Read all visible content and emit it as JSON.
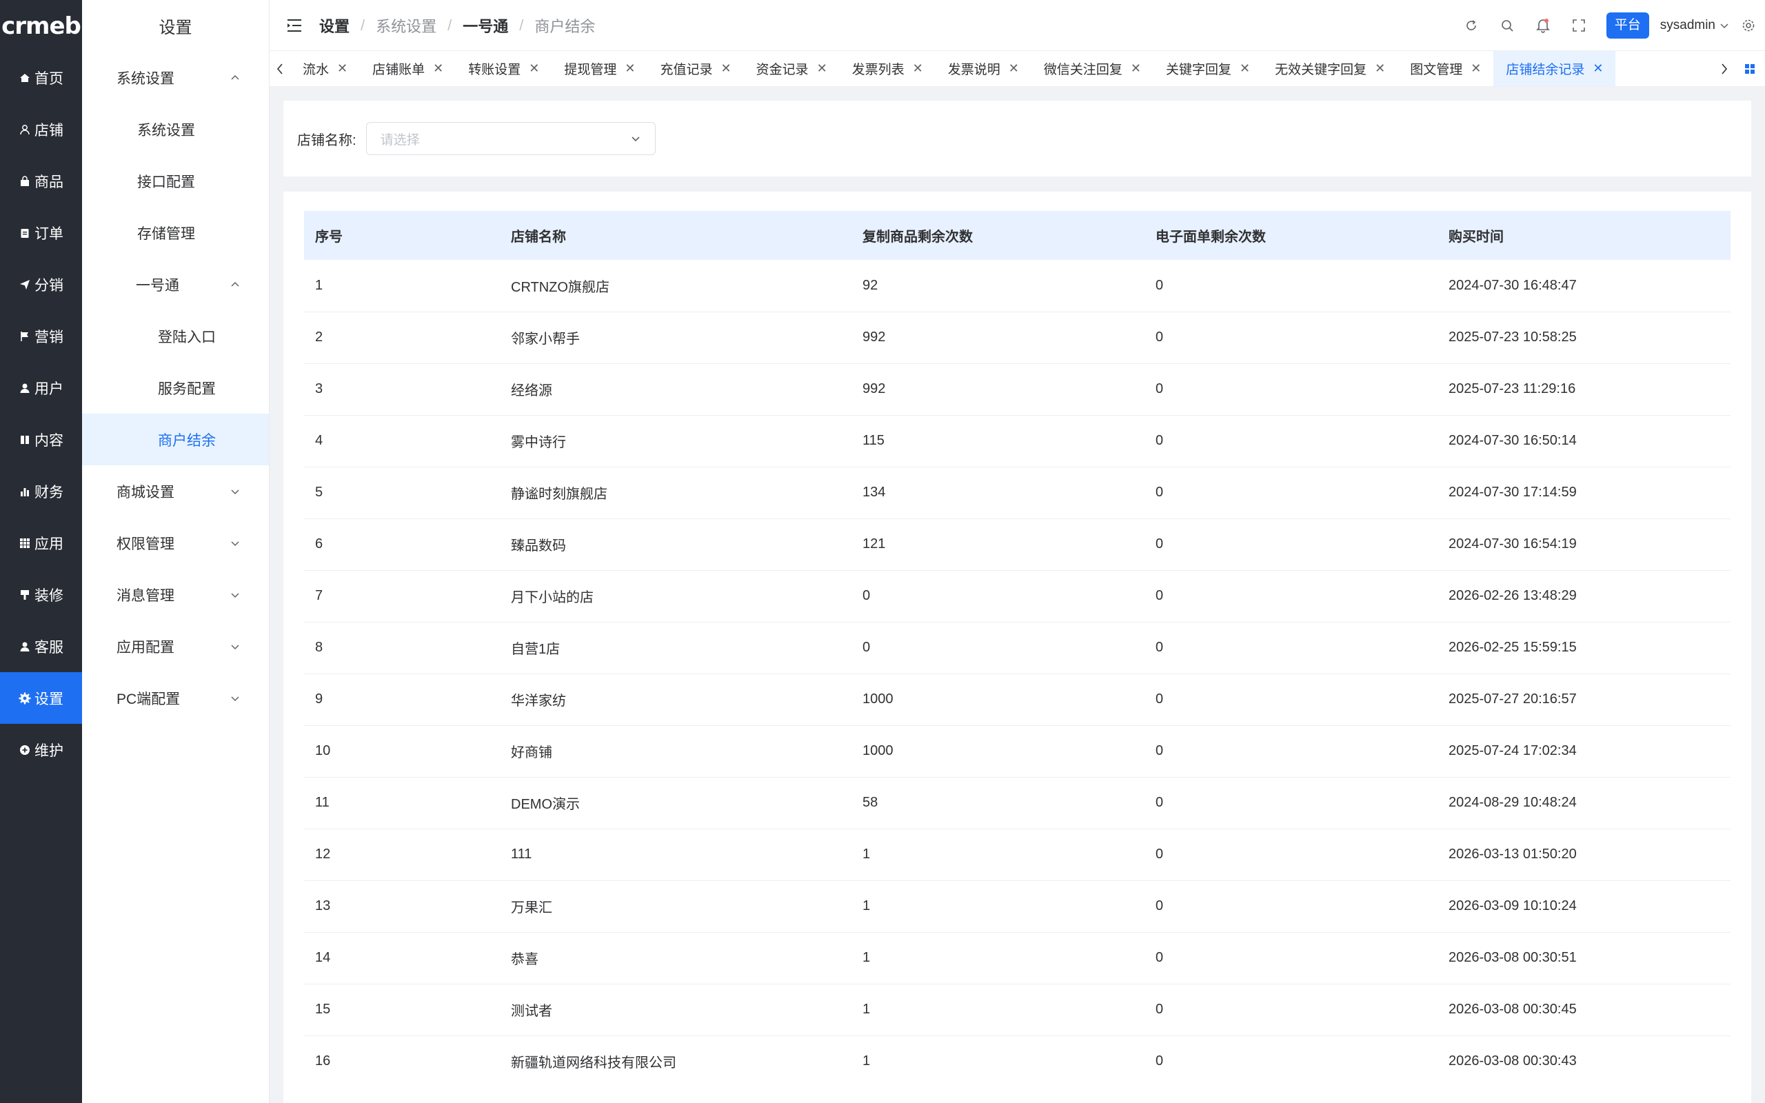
{
  "logo": "crmeb",
  "rail": {
    "items": [
      {
        "label": "首页",
        "icon": "home-icon"
      },
      {
        "label": "店铺",
        "icon": "user-outline-icon"
      },
      {
        "label": "商品",
        "icon": "bag-icon"
      },
      {
        "label": "订单",
        "icon": "clipboard-icon"
      },
      {
        "label": "分销",
        "icon": "send-icon"
      },
      {
        "label": "营销",
        "icon": "flag-icon"
      },
      {
        "label": "用户",
        "icon": "user-icon"
      },
      {
        "label": "内容",
        "icon": "book-icon"
      },
      {
        "label": "财务",
        "icon": "bar-chart-icon"
      },
      {
        "label": "应用",
        "icon": "grid-icon"
      },
      {
        "label": "装修",
        "icon": "brush-icon"
      },
      {
        "label": "客服",
        "icon": "agent-icon"
      },
      {
        "label": "设置",
        "icon": "gear-icon",
        "active": true
      },
      {
        "label": "维护",
        "icon": "plus-circle-icon"
      }
    ]
  },
  "submenu": {
    "title": "设置",
    "system_settings": "系统设置",
    "system_settings_items": [
      "系统设置",
      "接口配置",
      "存储管理"
    ],
    "yihaotong": "一号通",
    "yihaotong_items": [
      "登陆入口",
      "服务配置",
      "商户结余"
    ],
    "groups": [
      "商城设置",
      "权限管理",
      "消息管理",
      "应用配置",
      "PC端配置"
    ]
  },
  "header": {
    "crumbs": [
      "设置",
      "系统设置",
      "一号通",
      "商户结余"
    ],
    "platform": "平台",
    "user": "sysadmin"
  },
  "tabs": [
    {
      "label": "流水"
    },
    {
      "label": "店铺账单"
    },
    {
      "label": "转账设置"
    },
    {
      "label": "提现管理"
    },
    {
      "label": "充值记录"
    },
    {
      "label": "资金记录"
    },
    {
      "label": "发票列表"
    },
    {
      "label": "发票说明"
    },
    {
      "label": "微信关注回复"
    },
    {
      "label": "关键字回复"
    },
    {
      "label": "无效关键字回复"
    },
    {
      "label": "图文管理"
    },
    {
      "label": "店铺结余记录",
      "active": true
    }
  ],
  "filter": {
    "label": "店铺名称:",
    "placeholder": "请选择"
  },
  "table": {
    "headers": [
      "序号",
      "店铺名称",
      "复制商品剩余次数",
      "电子面单剩余次数",
      "购买时间"
    ],
    "rows": [
      [
        "1",
        "CRTNZO旗舰店",
        "92",
        "0",
        "2024-07-30 16:48:47"
      ],
      [
        "2",
        "邻家小帮手",
        "992",
        "0",
        "2025-07-23 10:58:25"
      ],
      [
        "3",
        "经络源",
        "992",
        "0",
        "2025-07-23 11:29:16"
      ],
      [
        "4",
        "雾中诗行",
        "115",
        "0",
        "2024-07-30 16:50:14"
      ],
      [
        "5",
        "静谧时刻旗舰店",
        "134",
        "0",
        "2024-07-30 17:14:59"
      ],
      [
        "6",
        "臻品数码",
        "121",
        "0",
        "2024-07-30 16:54:19"
      ],
      [
        "7",
        "月下小站的店",
        "0",
        "0",
        "2026-02-26 13:48:29"
      ],
      [
        "8",
        "自营1店",
        "0",
        "0",
        "2026-02-25 15:59:15"
      ],
      [
        "9",
        "华洋家纺",
        "1000",
        "0",
        "2025-07-27 20:16:57"
      ],
      [
        "10",
        "好商铺",
        "1000",
        "0",
        "2025-07-24 17:02:34"
      ],
      [
        "11",
        "DEMO演示",
        "58",
        "0",
        "2024-08-29 10:48:24"
      ],
      [
        "12",
        "111",
        "1",
        "0",
        "2026-03-13 01:50:20"
      ],
      [
        "13",
        "万果汇",
        "1",
        "0",
        "2026-03-09 10:10:24"
      ],
      [
        "14",
        "恭喜",
        "1",
        "0",
        "2026-03-08 00:30:51"
      ],
      [
        "15",
        "测试者",
        "1",
        "0",
        "2026-03-08 00:30:45"
      ],
      [
        "16",
        "新疆轨道网络科技有限公司",
        "1",
        "0",
        "2026-03-08 00:30:43"
      ]
    ]
  },
  "colors": {
    "primary": "#1e6ff2",
    "rail_bg": "#282c34",
    "active_bg": "#e8f3ff"
  }
}
